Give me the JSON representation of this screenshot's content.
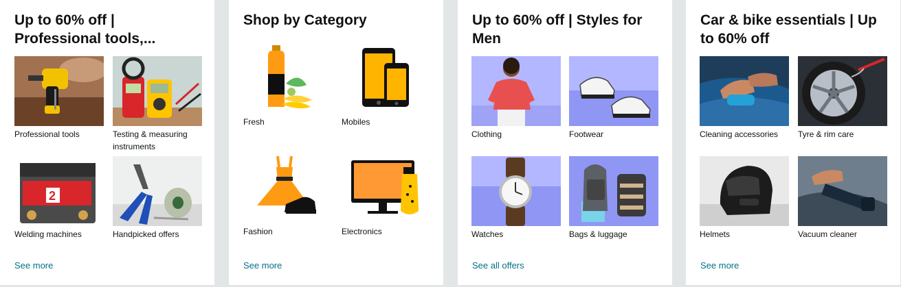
{
  "cards": [
    {
      "title": "Up to 60% off | Professional tools,...",
      "items": [
        {
          "label": "Professional tools",
          "image": "drill-image"
        },
        {
          "label": "Testing & measuring instruments",
          "image": "multimeter-image"
        },
        {
          "label": "Welding machines",
          "image": "welding-machine-image"
        },
        {
          "label": "Handpicked offers",
          "image": "pliers-solder-image"
        }
      ],
      "link": "See more"
    },
    {
      "title": "Shop by Category",
      "items": [
        {
          "label": "Fresh",
          "image": "juice-fruit-icon"
        },
        {
          "label": "Mobiles",
          "image": "smartphones-icon"
        },
        {
          "label": "Fashion",
          "image": "dress-shoe-icon"
        },
        {
          "label": "Electronics",
          "image": "monitor-usb-icon"
        }
      ],
      "link": "See more"
    },
    {
      "title": "Up to 60% off | Styles for Men",
      "items": [
        {
          "label": "Clothing",
          "image": "man-shirt-image"
        },
        {
          "label": "Footwear",
          "image": "sneakers-image"
        },
        {
          "label": "Watches",
          "image": "watch-image"
        },
        {
          "label": "Bags & luggage",
          "image": "backpack-image"
        }
      ],
      "link": "See all offers"
    },
    {
      "title": "Car & bike essentials | Up to 60% off",
      "items": [
        {
          "label": "Cleaning accessories",
          "image": "car-cleaning-image"
        },
        {
          "label": "Tyre & rim care",
          "image": "rim-cleaning-image"
        },
        {
          "label": "Helmets",
          "image": "helmet-image"
        },
        {
          "label": "Vacuum cleaner",
          "image": "car-vacuum-image"
        }
      ],
      "link": "See more"
    }
  ],
  "colors": {
    "background": "#e3e6e6",
    "card": "#ffffff",
    "link": "#007185",
    "text": "#0f1111",
    "category_yellow": "#ffb400",
    "category_orange": "#ff9933"
  }
}
